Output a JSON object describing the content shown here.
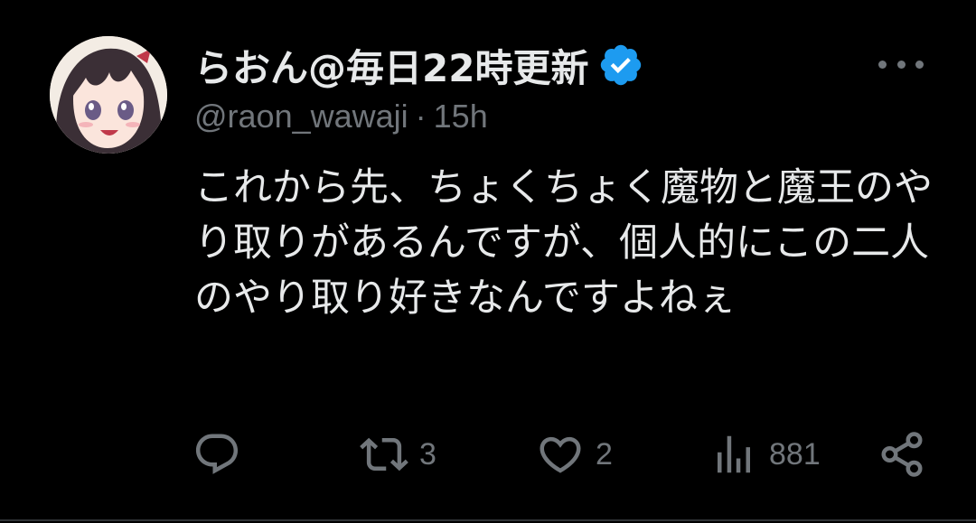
{
  "colors": {
    "background": "#000000",
    "text_primary": "#e7e9ea",
    "text_secondary": "#71767b",
    "verified_blue": "#1d9bf0"
  },
  "author": {
    "display_name": "らおん@毎日22時更新",
    "handle": "@raon_wawaji",
    "separator": "·",
    "time_ago": "15h",
    "verified": true,
    "avatar_icon": "anime-girl-avatar"
  },
  "tweet": {
    "text": "これから先、ちょくちょく魔物と魔王のやり取りがあるんですが、個人的にこの二人のやり取り好きなんですよねぇ"
  },
  "actions": {
    "reply": {
      "icon": "reply-icon",
      "count": ""
    },
    "retweet": {
      "icon": "retweet-icon",
      "count": "3"
    },
    "like": {
      "icon": "heart-icon",
      "count": "2"
    },
    "views": {
      "icon": "views-icon",
      "count": "881"
    },
    "share": {
      "icon": "share-icon",
      "count": ""
    }
  },
  "more_menu_icon": "more-icon"
}
